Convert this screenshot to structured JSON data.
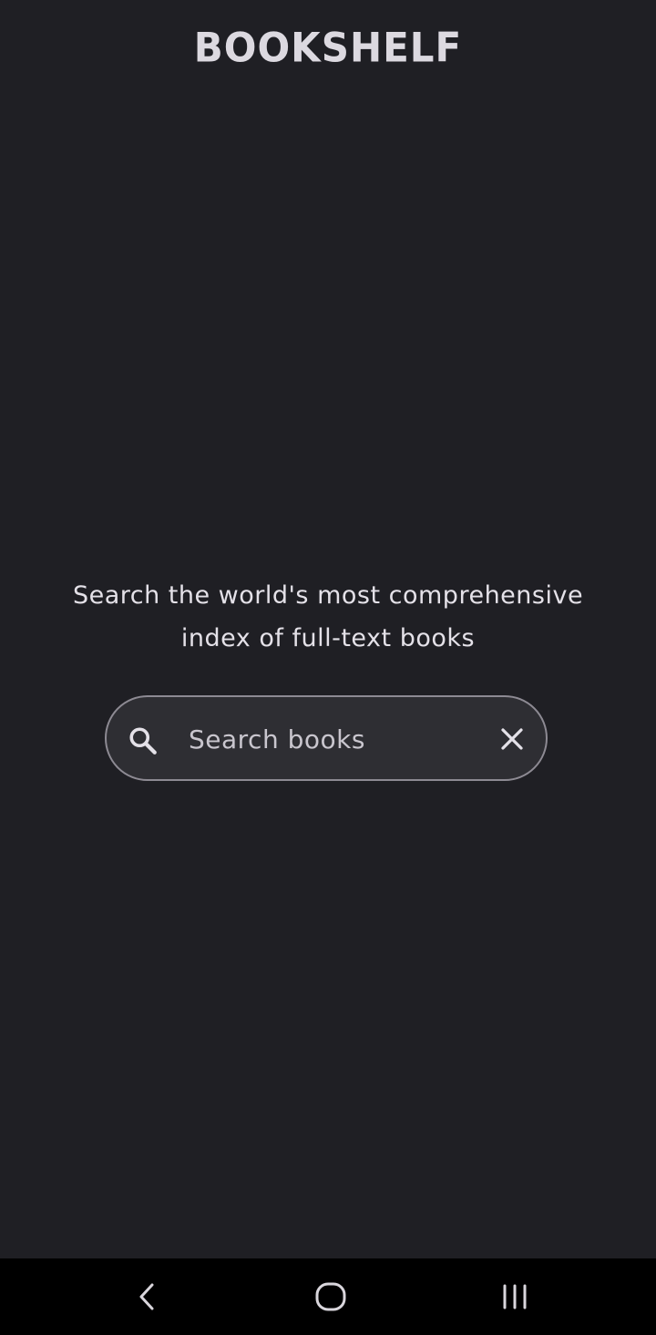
{
  "app": {
    "title": "BOOKSHELF"
  },
  "main": {
    "tagline_line1": "Search the world's most comprehensive",
    "tagline_line2": "index of full-text books"
  },
  "search": {
    "placeholder": "Search books",
    "value": "",
    "search_icon": "search-icon",
    "clear_icon": "close-icon"
  },
  "system_nav": {
    "back_icon": "chevron-left-icon",
    "home_icon": "home-icon",
    "recents_icon": "recents-icon"
  },
  "colors": {
    "background": "#1f1f24",
    "search_field_bg": "#2e2e33",
    "search_field_border": "#8d8a93",
    "text": "#e4e1e8",
    "nav_bar": "#000000"
  }
}
